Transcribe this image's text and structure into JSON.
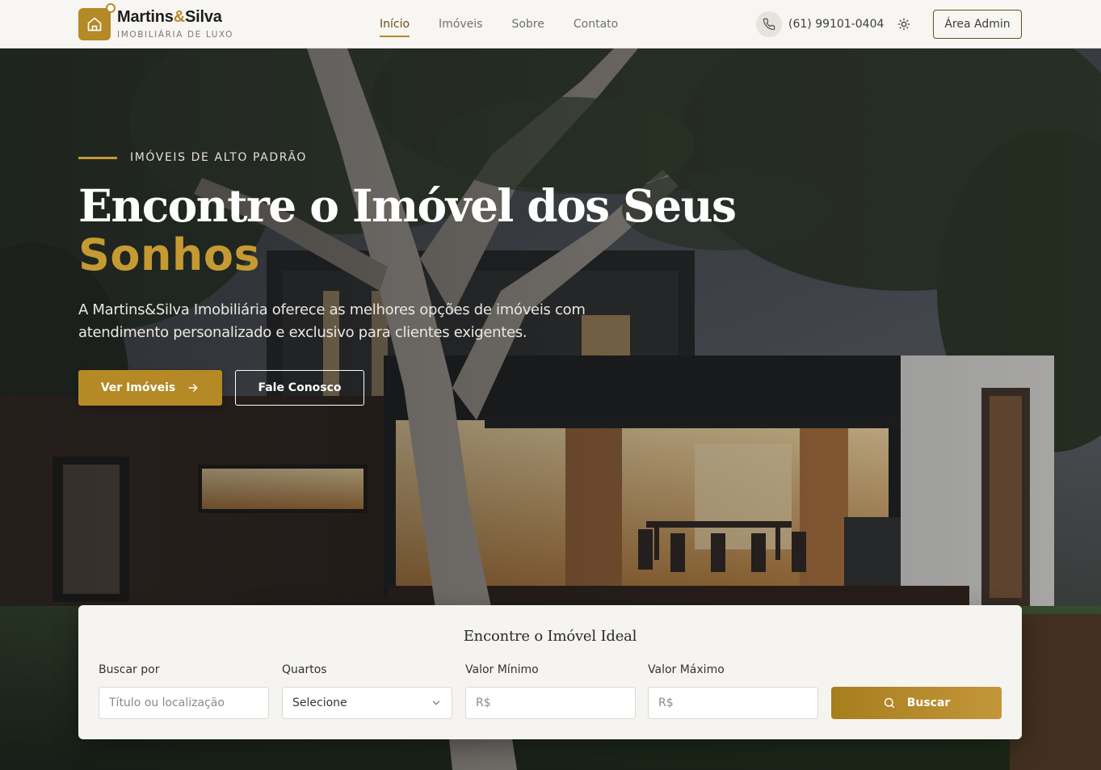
{
  "header": {
    "brand_name_a": "Martins",
    "brand_amp": "&",
    "brand_name_b": "Silva",
    "brand_subtitle": "IMOBILIÁRIA DE LUXO",
    "nav": [
      {
        "label": "Início",
        "active": true
      },
      {
        "label": "Imóveis",
        "active": false
      },
      {
        "label": "Sobre",
        "active": false
      },
      {
        "label": "Contato",
        "active": false
      }
    ],
    "phone": "(61) 99101-0404",
    "admin_label": "Área Admin",
    "icons": {
      "logo": "home-icon",
      "phone": "phone-icon",
      "theme": "sun-icon"
    }
  },
  "hero": {
    "eyebrow": "IMÓVEIS DE ALTO PADRÃO",
    "title_line1": "Encontre o Imóvel dos Seus",
    "title_line2": "Sonhos",
    "lead": "A Martins&Silva Imobiliária oferece as melhores opções de imóveis com atendimento personalizado e exclusivo para clientes exigentes.",
    "primary_button": "Ver Imóveis",
    "secondary_button": "Fale Conosco"
  },
  "search": {
    "title": "Encontre o Imóvel Ideal",
    "fields": [
      {
        "label": "Buscar por",
        "placeholder": "Título ou localização"
      },
      {
        "label": "Quartos",
        "value": "Selecione"
      },
      {
        "label": "Valor Mínimo",
        "placeholder": "R$"
      },
      {
        "label": "Valor Máximo",
        "placeholder": "R$"
      }
    ],
    "button": "Buscar"
  },
  "colors": {
    "accent": "#b58a26",
    "header_bg": "#f7f6f3",
    "card_bg": "#f5f4f1"
  }
}
